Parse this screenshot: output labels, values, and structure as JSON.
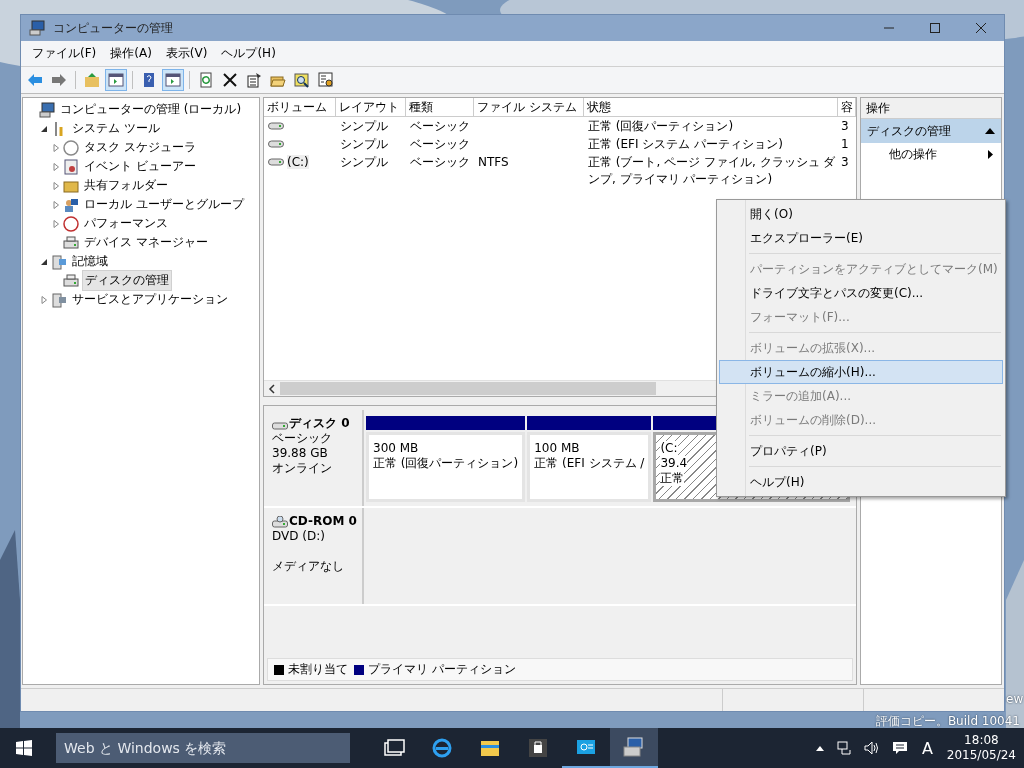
{
  "desktop": {
    "texts": [
      "ew",
      "評価コピー。Build 10041"
    ]
  },
  "window": {
    "title": "コンピューターの管理",
    "active": false
  },
  "menu": [
    "ファイル(F)",
    "操作(A)",
    "表示(V)",
    "ヘルプ(H)"
  ],
  "toolbar": [
    [
      {
        "kind": "back",
        "pressed": false
      },
      {
        "kind": "forward",
        "pressed": false
      }
    ],
    [
      {
        "kind": "up",
        "pressed": false
      },
      {
        "kind": "tree",
        "pressed": true
      }
    ],
    [
      {
        "kind": "help",
        "pressed": false
      },
      {
        "kind": "pane",
        "pressed": true
      }
    ],
    [
      {
        "kind": "refresh",
        "pressed": false
      },
      {
        "kind": "delete",
        "pressed": false
      },
      {
        "kind": "properties",
        "pressed": false
      },
      {
        "kind": "open",
        "pressed": false
      },
      {
        "kind": "search",
        "pressed": false
      },
      {
        "kind": "settings",
        "pressed": false
      }
    ]
  ],
  "tree": [
    {
      "label": "コンピューターの管理 (ローカル)",
      "kind": "computer",
      "selected": false,
      "children": [
        {
          "label": "システム ツール",
          "kind": "tools",
          "expanded": true,
          "selected": false,
          "children": [
            {
              "label": "タスク スケジューラ",
              "kind": "clock",
              "expanded": false,
              "selected": false
            },
            {
              "label": "イベント ビューアー",
              "kind": "event",
              "expanded": false,
              "selected": false
            },
            {
              "label": "共有フォルダー",
              "kind": "folder",
              "expanded": false,
              "selected": false
            },
            {
              "label": "ローカル ユーザーとグループ",
              "kind": "users",
              "expanded": false,
              "selected": false
            },
            {
              "label": "パフォーマンス",
              "kind": "perf",
              "expanded": false,
              "selected": false
            },
            {
              "label": "デバイス マネージャー",
              "kind": "device",
              "selected": false
            }
          ]
        },
        {
          "label": "記憶域",
          "kind": "storage",
          "expanded": true,
          "selected": false,
          "children": [
            {
              "label": "ディスクの管理",
              "kind": "disk",
              "selected": true
            }
          ]
        },
        {
          "label": "サービスとアプリケーション",
          "kind": "services",
          "expanded": false,
          "selected": false
        }
      ]
    }
  ],
  "volumes": {
    "columns": [
      "ボリューム",
      "レイアウト",
      "種類",
      "ファイル システム",
      "状態",
      "容"
    ],
    "rows": [
      {
        "cells": [
          "",
          "シンプル",
          "ベーシック",
          "",
          "正常 (回復パーティション)",
          "3"
        ]
      },
      {
        "cells": [
          "",
          "シンプル",
          "ベーシック",
          "",
          "正常 (EFI システム パーティション)",
          "1"
        ]
      },
      {
        "cells": [
          "(C:)",
          "シンプル",
          "ベーシック",
          "NTFS",
          "正常 (ブート, ページ ファイル, クラッシュ ダンプ, プライマリ パーティション)",
          "3"
        ]
      }
    ]
  },
  "disks": [
    {
      "kind": "disk",
      "name": "ディスク 0",
      "lines": [
        "ベーシック",
        "39.88 GB",
        "オンライン"
      ],
      "partitions": [
        {
          "lines": [
            "300 MB",
            "正常 (回復パーティション)"
          ],
          "selected": false
        },
        {
          "lines": [
            "100 MB",
            "正常 (EFI システム /"
          ],
          "selected": false
        },
        {
          "lines": [
            "(C:",
            "39.4",
            "正常"
          ],
          "selected": true
        }
      ]
    },
    {
      "kind": "cdrom",
      "name": "CD-ROM 0",
      "lines": [
        "DVD (D:)"
      ],
      "status": "メディアなし"
    }
  ],
  "legend": [
    {
      "label": "未割り当て",
      "color": "#000000"
    },
    {
      "label": "プライマリ パーティション",
      "color": "#000080"
    }
  ],
  "context_menu": [
    [
      {
        "label": "開く(O)",
        "disabled": false,
        "selected": false
      },
      {
        "label": "エクスプローラー(E)",
        "disabled": false,
        "selected": false
      }
    ],
    [
      {
        "label": "パーティションをアクティブとしてマーク(M)",
        "disabled": true,
        "selected": false
      },
      {
        "label": "ドライブ文字とパスの変更(C)...",
        "disabled": false,
        "selected": false
      },
      {
        "label": "フォーマット(F)...",
        "disabled": true,
        "selected": false
      }
    ],
    [
      {
        "label": "ボリュームの拡張(X)...",
        "disabled": true,
        "selected": false
      },
      {
        "label": "ボリュームの縮小(H)...",
        "disabled": false,
        "selected": true
      },
      {
        "label": "ミラーの追加(A)...",
        "disabled": true,
        "selected": false
      },
      {
        "label": "ボリュームの削除(D)...",
        "disabled": true,
        "selected": false
      }
    ],
    [
      {
        "label": "プロパティ(P)",
        "disabled": false,
        "selected": false
      }
    ],
    [
      {
        "label": "ヘルプ(H)",
        "disabled": false,
        "selected": false
      }
    ]
  ],
  "actions": {
    "title": "操作",
    "section": {
      "label": "ディスクの管理",
      "expanded": true
    },
    "items": [
      "他の操作"
    ]
  },
  "taskbar": {
    "search": {
      "placeholder": "Web と Windows を検索"
    },
    "apps": [
      {
        "kind": "taskview",
        "running": false,
        "active": false
      },
      {
        "kind": "browser",
        "running": false,
        "active": false
      },
      {
        "kind": "explorer",
        "running": false,
        "active": false
      },
      {
        "kind": "store",
        "running": false,
        "active": false
      },
      {
        "kind": "app",
        "running": true,
        "active": false
      },
      {
        "kind": "mgmt",
        "running": true,
        "active": true
      }
    ],
    "ime": "A",
    "time": "18:08",
    "date": "2015/05/24"
  }
}
